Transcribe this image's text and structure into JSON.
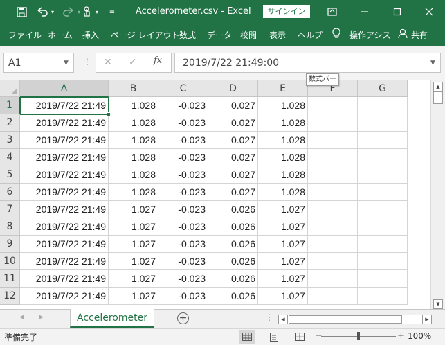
{
  "title_bar": {
    "save_icon": "save-icon",
    "undo_icon": "undo-icon",
    "redo_icon": "redo-icon",
    "touch_icon": "touch-mode-icon",
    "title": "Accelerometer.csv  -  Excel",
    "signin_label": "サインイン",
    "restore_ribbon_icon": "ribbon-display-icon",
    "minimize_icon": "minimize-icon",
    "maximize_icon": "maximize-icon",
    "close_icon": "close-icon"
  },
  "ribbon": {
    "tabs": [
      "ファイル",
      "ホーム",
      "挿入",
      "ページ レイアウト",
      "数式",
      "データ",
      "校閲",
      "表示",
      "ヘルプ"
    ],
    "tell_me": "操作アシス",
    "share": "共有"
  },
  "formula_bar": {
    "name_box": "A1",
    "formula": "2019/7/22  21:49:00",
    "tooltip": "数式バー"
  },
  "sheet": {
    "columns": [
      "A",
      "B",
      "C",
      "D",
      "E",
      "F",
      "G"
    ],
    "selected_cell": "A1",
    "rows": [
      {
        "n": "1",
        "cells": [
          "2019/7/22 21:49",
          "1.028",
          "-0.023",
          "0.027",
          "1.028"
        ]
      },
      {
        "n": "2",
        "cells": [
          "2019/7/22 21:49",
          "1.028",
          "-0.023",
          "0.027",
          "1.028"
        ]
      },
      {
        "n": "3",
        "cells": [
          "2019/7/22 21:49",
          "1.028",
          "-0.023",
          "0.027",
          "1.028"
        ]
      },
      {
        "n": "4",
        "cells": [
          "2019/7/22 21:49",
          "1.028",
          "-0.023",
          "0.027",
          "1.028"
        ]
      },
      {
        "n": "5",
        "cells": [
          "2019/7/22 21:49",
          "1.028",
          "-0.023",
          "0.027",
          "1.028"
        ]
      },
      {
        "n": "6",
        "cells": [
          "2019/7/22 21:49",
          "1.028",
          "-0.023",
          "0.027",
          "1.028"
        ]
      },
      {
        "n": "7",
        "cells": [
          "2019/7/22 21:49",
          "1.027",
          "-0.023",
          "0.026",
          "1.027"
        ]
      },
      {
        "n": "8",
        "cells": [
          "2019/7/22 21:49",
          "1.027",
          "-0.023",
          "0.026",
          "1.027"
        ]
      },
      {
        "n": "9",
        "cells": [
          "2019/7/22 21:49",
          "1.027",
          "-0.023",
          "0.026",
          "1.027"
        ]
      },
      {
        "n": "10",
        "cells": [
          "2019/7/22 21:49",
          "1.027",
          "-0.023",
          "0.026",
          "1.027"
        ]
      },
      {
        "n": "11",
        "cells": [
          "2019/7/22 21:49",
          "1.027",
          "-0.023",
          "0.026",
          "1.027"
        ]
      },
      {
        "n": "12",
        "cells": [
          "2019/7/22 21:49",
          "1.027",
          "-0.023",
          "0.026",
          "1.027"
        ]
      }
    ]
  },
  "sheet_tabs": {
    "active": "Accelerometer"
  },
  "status_bar": {
    "ready": "準備完了",
    "zoom": "100%"
  },
  "colors": {
    "accent": "#217346",
    "chrome_bg": "#f3f3f3"
  }
}
